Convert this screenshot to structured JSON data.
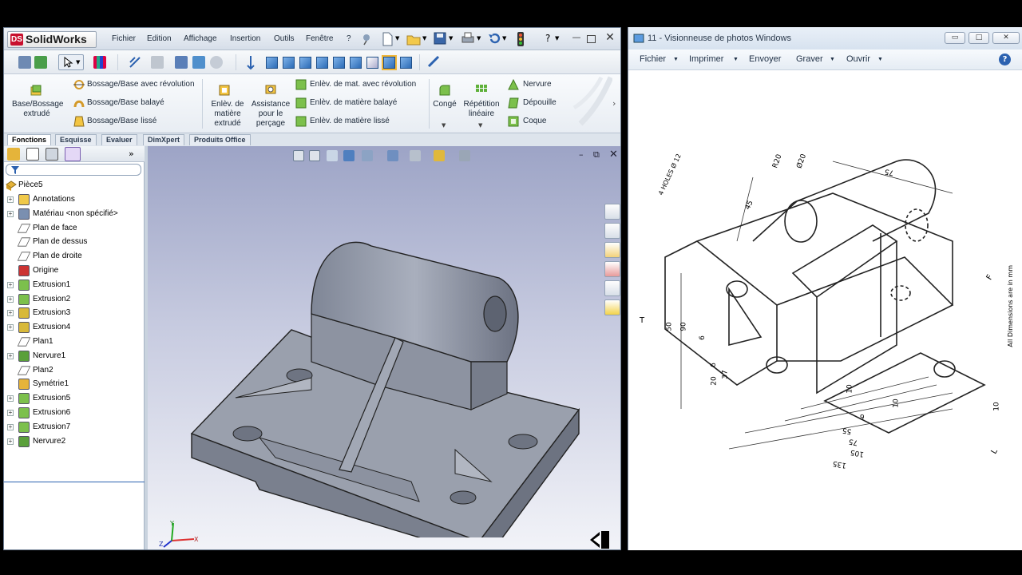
{
  "solidworks": {
    "logo_text": "SolidWorks",
    "menu": [
      "Fichier",
      "Edition",
      "Affichage",
      "Insertion",
      "Outils",
      "Fenêtre",
      "?"
    ],
    "help_label": "?",
    "ribbon": {
      "base_extrude": "Base/Bossage extrudé",
      "revolve_boss": "Bossage/Base avec révolution",
      "sweep_boss": "Bossage/Base balayé",
      "loft_boss": "Bossage/Base lissé",
      "extruded_cut": "Enlèv. de matière extrudé",
      "hole_wizard": "Assistance pour le perçage",
      "revolve_cut": "Enlèv. de mat. avec révolution",
      "sweep_cut": "Enlèv. de matière balayé",
      "loft_cut": "Enlèv. de matière lissé",
      "fillet": "Congé",
      "linear_pattern": "Répétition linéaire",
      "rib": "Nervure",
      "draft": "Dépouille",
      "shell": "Coque"
    },
    "tabs": [
      "Fonctions",
      "Esquisse",
      "Evaluer",
      "DimXpert",
      "Produits Office"
    ],
    "feature_tree": {
      "root": "Pièce5",
      "items": [
        {
          "label": "Annotations",
          "icon": "annotation-icon",
          "expand": true
        },
        {
          "label": "Matériau <non spécifié>",
          "icon": "material-icon",
          "expand": true
        },
        {
          "label": "Plan de face",
          "icon": "plane-icon",
          "expand": false
        },
        {
          "label": "Plan de dessus",
          "icon": "plane-icon",
          "expand": false
        },
        {
          "label": "Plan de droite",
          "icon": "plane-icon",
          "expand": false
        },
        {
          "label": "Origine",
          "icon": "origin-icon",
          "expand": false
        },
        {
          "label": "Extrusion1",
          "icon": "extrude-icon",
          "expand": true
        },
        {
          "label": "Extrusion2",
          "icon": "extrude-icon",
          "expand": true
        },
        {
          "label": "Extrusion3",
          "icon": "cut-icon",
          "expand": true
        },
        {
          "label": "Extrusion4",
          "icon": "cut-icon",
          "expand": true
        },
        {
          "label": "Plan1",
          "icon": "plane-icon",
          "expand": false
        },
        {
          "label": "Nervure1",
          "icon": "rib-icon",
          "expand": true
        },
        {
          "label": "Plan2",
          "icon": "plane-icon",
          "expand": false
        },
        {
          "label": "Symétrie1",
          "icon": "mirror-icon",
          "expand": false
        },
        {
          "label": "Extrusion5",
          "icon": "extrude-icon",
          "expand": true
        },
        {
          "label": "Extrusion6",
          "icon": "extrude-icon",
          "expand": true
        },
        {
          "label": "Extrusion7",
          "icon": "extrude-icon",
          "expand": true
        },
        {
          "label": "Nervure2",
          "icon": "rib-icon",
          "expand": true
        }
      ]
    },
    "axes": {
      "x": "X",
      "y": "Y",
      "z": "Z"
    }
  },
  "photo_viewer": {
    "title": "11 - Visionneuse de photos Windows",
    "menu": [
      "Fichier",
      "Imprimer",
      "Envoyer",
      "Graver",
      "Ouvrir"
    ],
    "drawing": {
      "note": "All Dimensions are in mm",
      "holes": "4 HOLES Ø 12",
      "dims": [
        "75",
        "R20",
        "Ø20",
        "45",
        "50",
        "90",
        "6",
        "6",
        "20",
        "37",
        "10",
        "10",
        "6",
        "55",
        "75",
        "105",
        "135",
        "10"
      ],
      "view_labels": [
        "T",
        "F",
        "L"
      ]
    }
  }
}
